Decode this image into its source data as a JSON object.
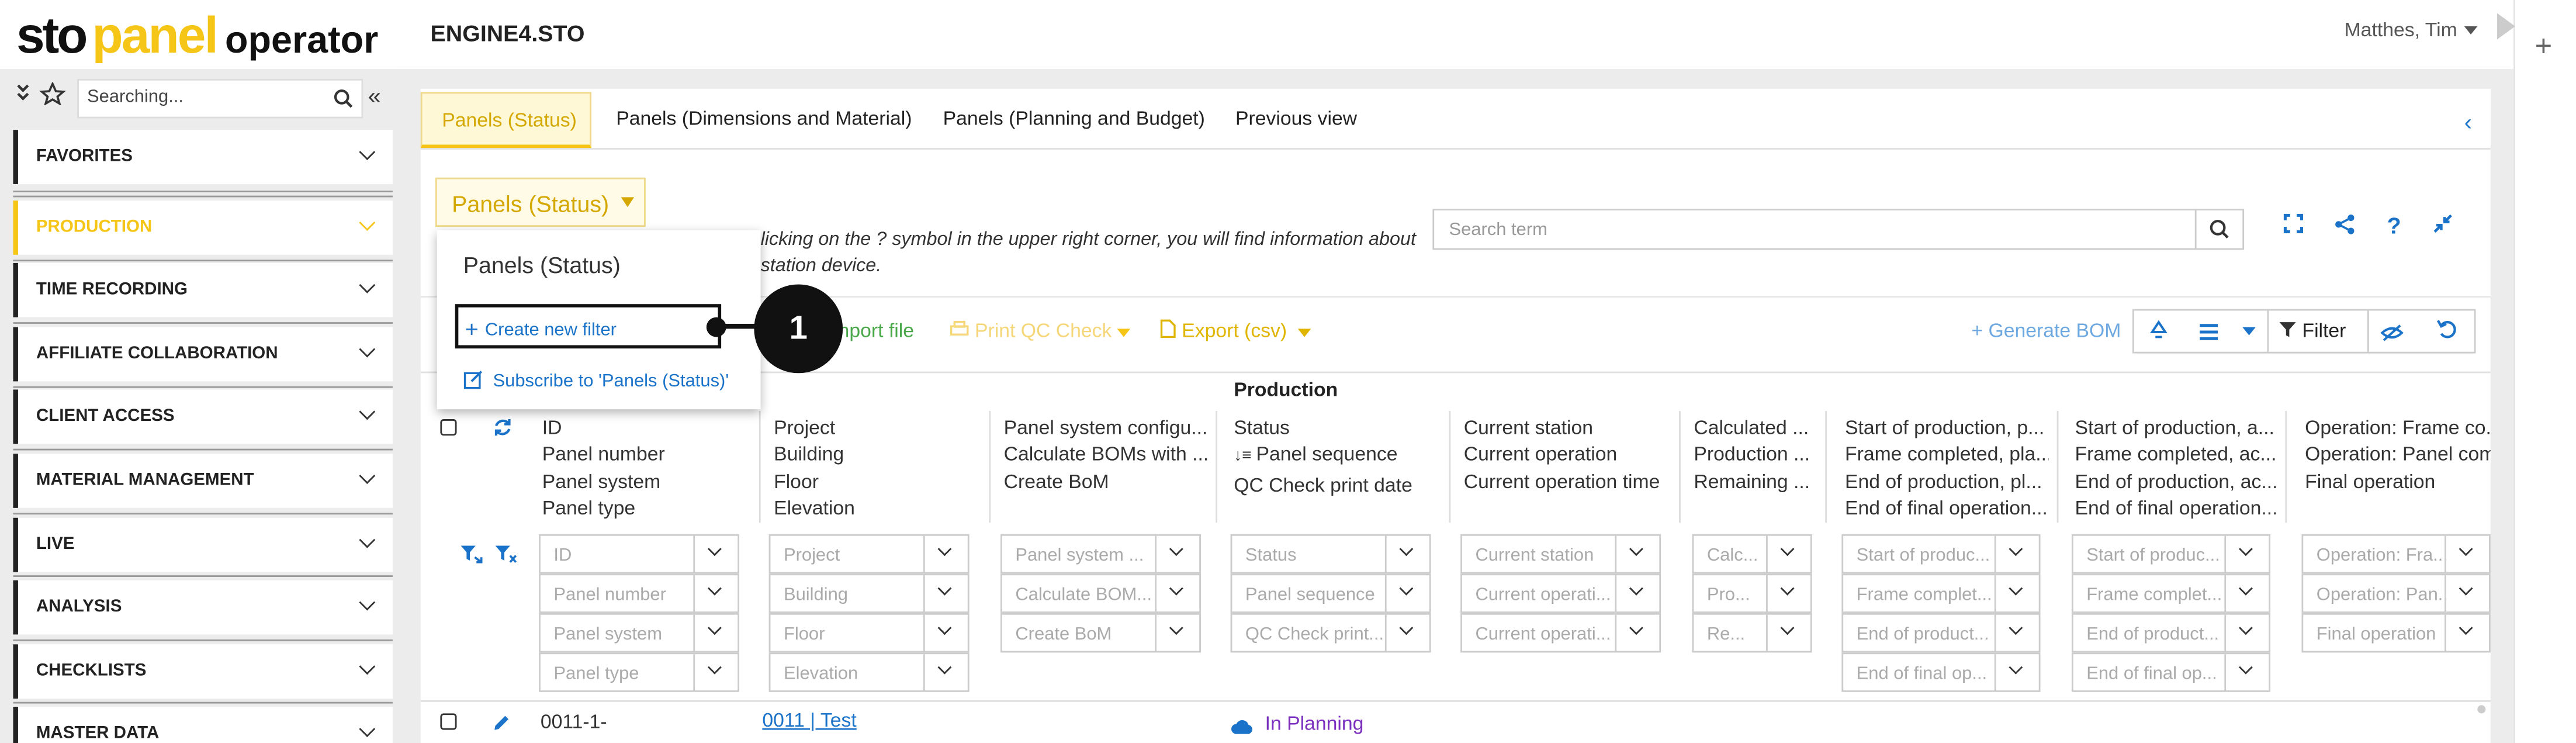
{
  "app": {
    "logo_sto": "sto",
    "logo_panel": "panel",
    "logo_operator": "operator",
    "engine": "ENGINE4.STO",
    "user": "Matthes, Tim"
  },
  "sidebar": {
    "search_value": "Searching...",
    "items": [
      {
        "label": "FAVORITES"
      },
      {
        "label": "PRODUCTION"
      },
      {
        "label": "TIME RECORDING"
      },
      {
        "label": "AFFILIATE COLLABORATION"
      },
      {
        "label": "CLIENT ACCESS"
      },
      {
        "label": "MATERIAL MANAGEMENT"
      },
      {
        "label": "LIVE"
      },
      {
        "label": "ANALYSIS"
      },
      {
        "label": "CHECKLISTS"
      },
      {
        "label": "MASTER DATA"
      }
    ]
  },
  "tabs": [
    "Panels (Status)",
    "Panels (Dimensions and Material)",
    "Panels (Planning and Budget)",
    "Previous view"
  ],
  "view_selector": "Panels (Status)",
  "hint": {
    "line1": "licking on the ? symbol in the upper right corner, you will find information about",
    "line2": "station device."
  },
  "search": {
    "placeholder": "Search term"
  },
  "toolbar": {
    "import": "mport file",
    "print_qc": "Print QC Check",
    "export": "Export (csv)",
    "generate_bom": "+ Generate BOM",
    "filter": "Filter"
  },
  "dropdown": {
    "title": "Panels (Status)",
    "create": "Create new filter",
    "subscribe": "Subscribe to 'Panels (Status)'"
  },
  "callout": "1",
  "table": {
    "group_header": "Production",
    "columns": [
      {
        "lines": [
          "ID",
          "Panel number",
          "Panel system",
          "Panel type"
        ],
        "filters": [
          "ID",
          "Panel number",
          "Panel system",
          "Panel type"
        ]
      },
      {
        "lines": [
          "Project",
          "Building",
          "Floor",
          "Elevation"
        ],
        "filters": [
          "Project",
          "Building",
          "Floor",
          "Elevation"
        ]
      },
      {
        "lines": [
          "Panel system configu...",
          "Calculate BOMs with ...",
          "Create BoM"
        ],
        "filters": [
          "Panel system ...",
          "Calculate BOM...",
          "Create BoM"
        ]
      },
      {
        "lines": [
          "Status",
          "Panel sequence",
          "QC Check print date"
        ],
        "filters": [
          "Status",
          "Panel sequence",
          "QC Check print..."
        ]
      },
      {
        "lines": [
          "Current station",
          "Current operation",
          "Current operation time"
        ],
        "filters": [
          "Current station",
          "Current operati...",
          "Current operati..."
        ]
      },
      {
        "lines": [
          "Calculated ...",
          "Production ...",
          "Remaining ..."
        ],
        "filters": [
          "Calc...",
          "Pro...",
          "Re..."
        ]
      },
      {
        "lines": [
          "Start of production, p...",
          "Frame completed, pla...",
          "End of production, pl...",
          "End of final operation..."
        ],
        "filters": [
          "Start of produc...",
          "Frame complet...",
          "End of product...",
          "End of final op..."
        ]
      },
      {
        "lines": [
          "Start of production, a...",
          "Frame completed, ac...",
          "End of production, ac...",
          "End of final operation..."
        ],
        "filters": [
          "Start of produc...",
          "Frame complet...",
          "End of product...",
          "End of final op..."
        ]
      },
      {
        "lines": [
          "Operation: Frame co...",
          "Operation: Panel com...",
          "Final operation"
        ],
        "filters": [
          "Operation: Fra...",
          "Operation: Pan...",
          "Final operation"
        ]
      }
    ],
    "rows": [
      {
        "id": "0011-1-",
        "project": "0011 | Test",
        "status": "In Planning"
      }
    ]
  },
  "colors": {
    "accent": "#f5c518",
    "link": "#1a73c9",
    "status": "#7b2fbe"
  }
}
